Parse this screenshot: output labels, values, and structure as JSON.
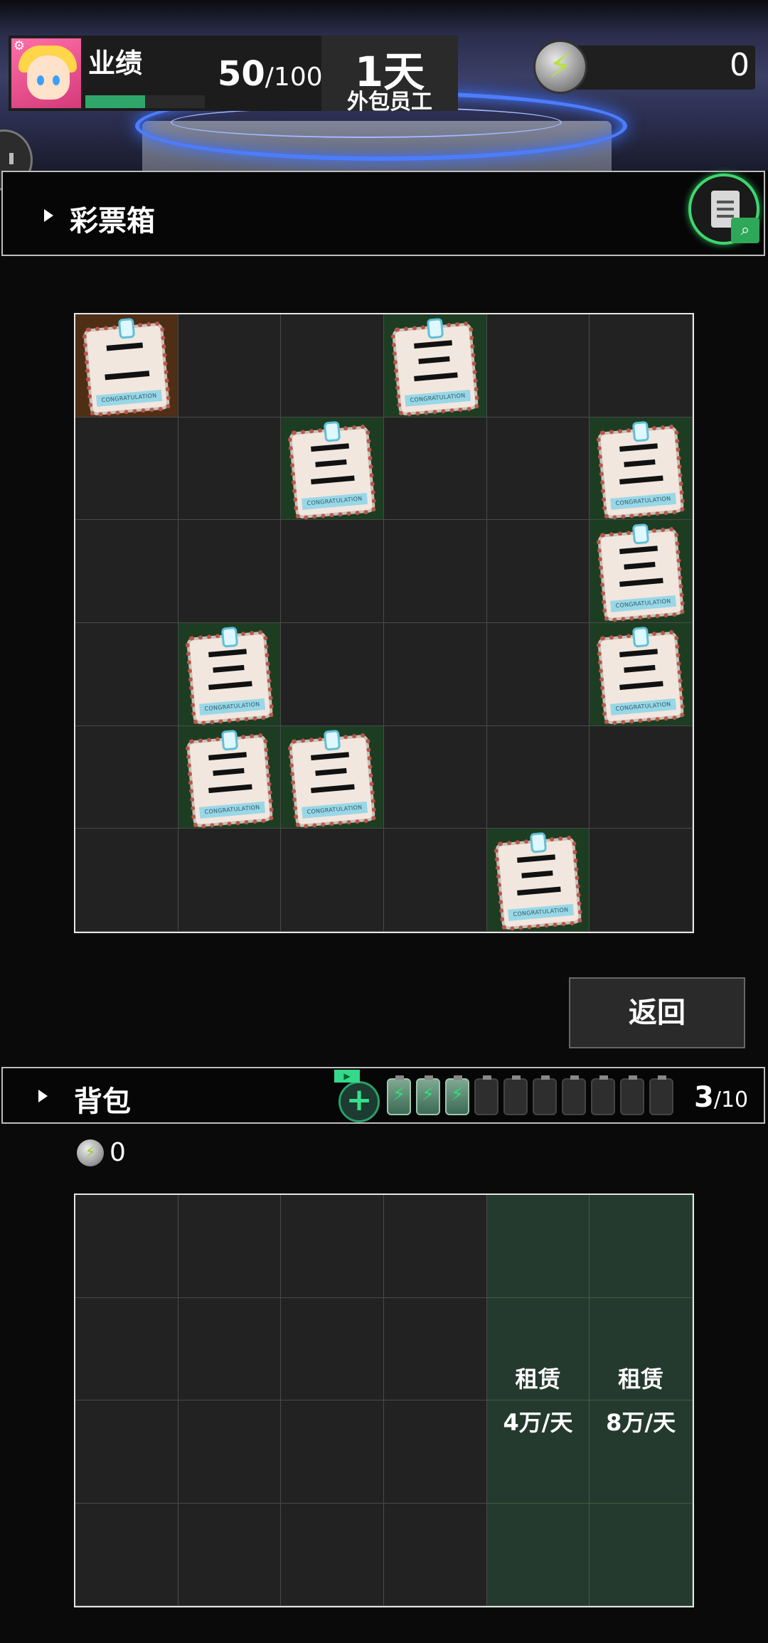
{
  "header": {
    "performance_label": "业绩",
    "performance_value": "50",
    "performance_max": "/100",
    "performance_fraction": 0.5,
    "day_count": "1天",
    "role": "外包员工",
    "energy_value": "0"
  },
  "lottery_box": {
    "title": "彩票箱",
    "ticket_label": "CONGRATULATION",
    "cells": [
      [
        "brown:二",
        "",
        "",
        "green:三",
        "",
        ""
      ],
      [
        "",
        "",
        "green:三",
        "",
        "",
        "green:三"
      ],
      [
        "",
        "",
        "",
        "",
        "",
        "green:三"
      ],
      [
        "",
        "green:三",
        "",
        "",
        "",
        "green:三"
      ],
      [
        "",
        "green:三",
        "green:三",
        "",
        "",
        ""
      ],
      [
        "",
        "",
        "",
        "",
        "green:三",
        ""
      ]
    ]
  },
  "return_button": "返回",
  "backpack": {
    "title": "背包",
    "ad_tag": "▶",
    "batteries_total": 10,
    "batteries_filled": 3,
    "count": "3",
    "count_max": "/10",
    "coins": "0",
    "rent": [
      {
        "label": "租赁",
        "price": "4万/天"
      },
      {
        "label": "租赁",
        "price": "8万/天"
      }
    ]
  },
  "colors": {
    "ticket_green_cell": "#1d3d22",
    "ticket_brown_cell": "#4f2e16",
    "rent_cell": "#253a2e",
    "accent_green": "#2fa76a"
  }
}
